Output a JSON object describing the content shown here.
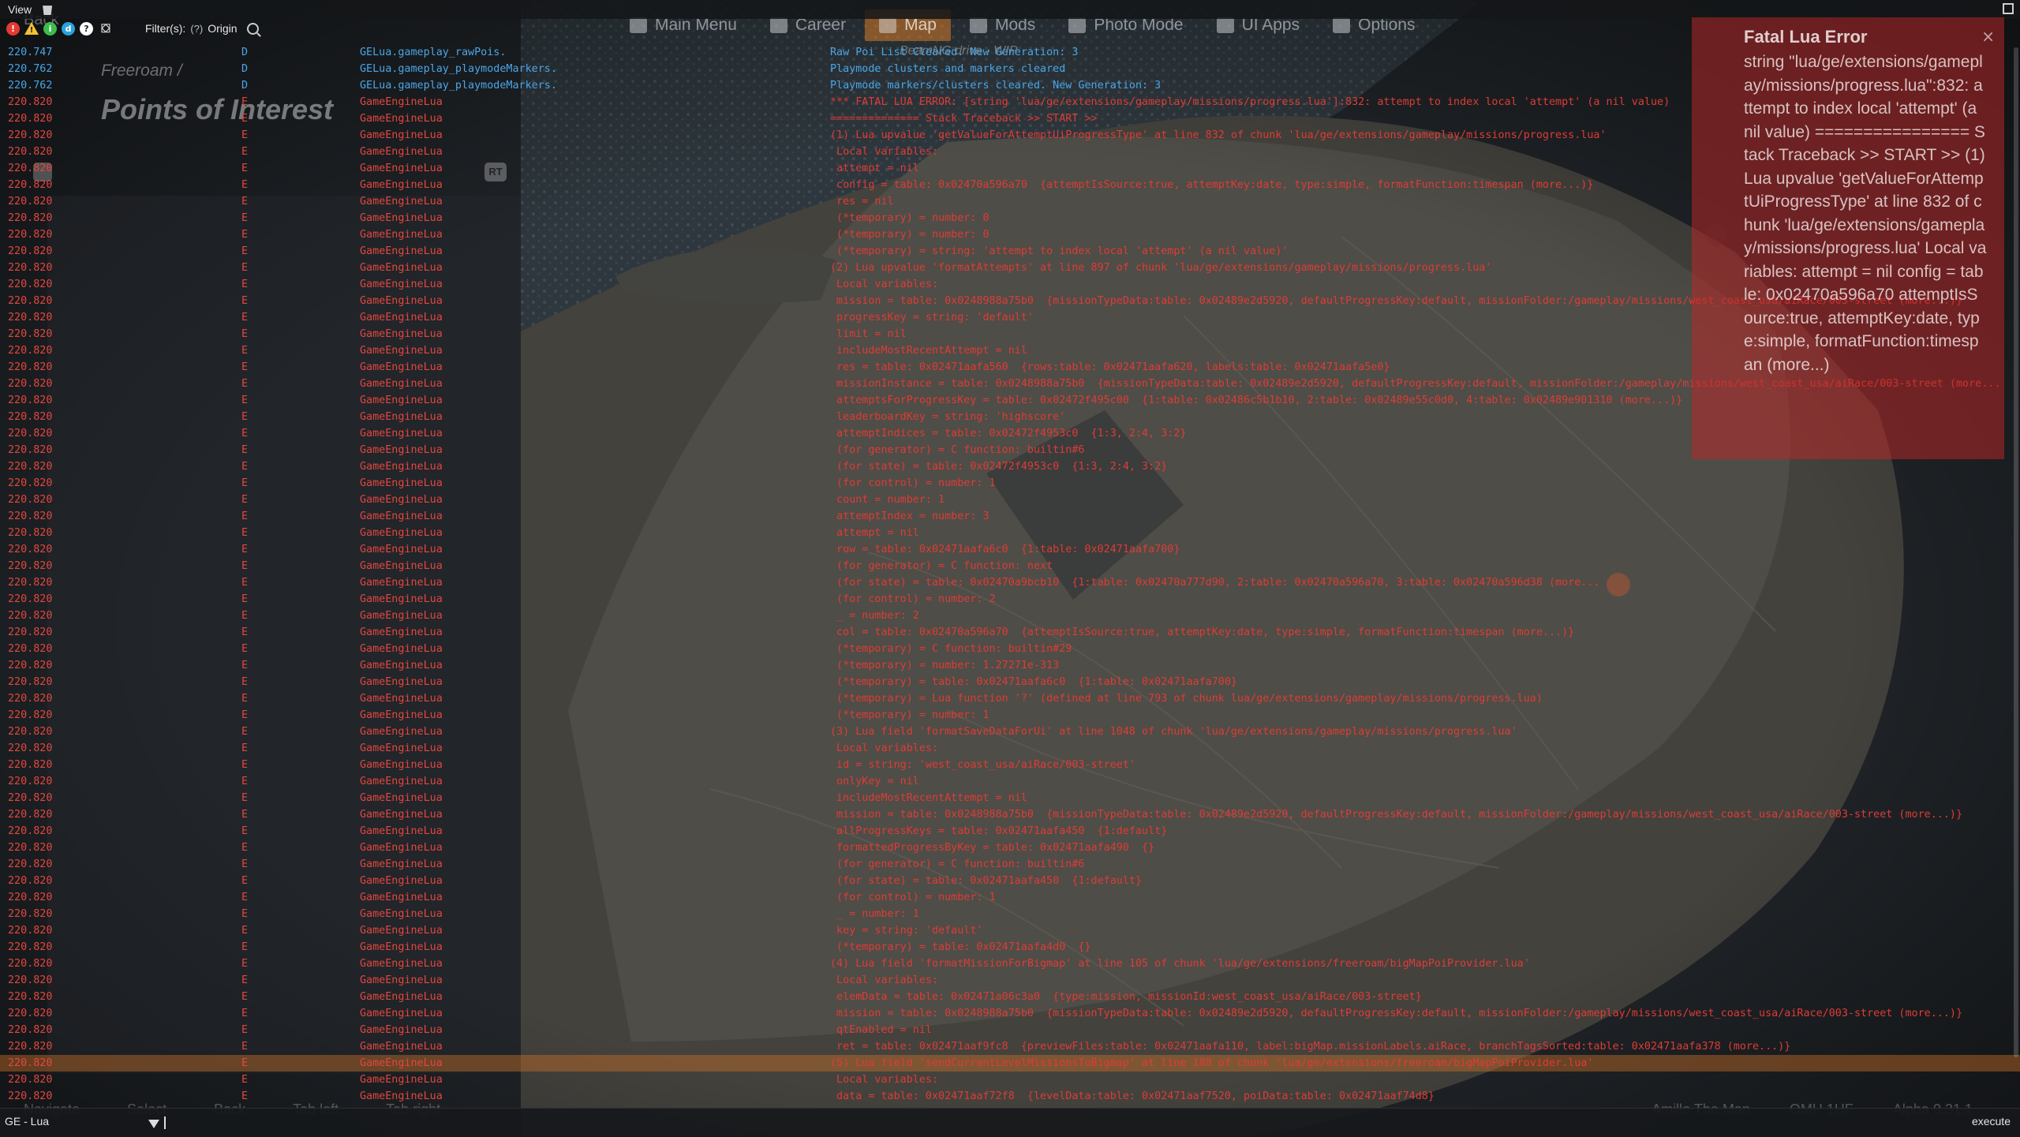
{
  "topbar": {
    "menu_view": "View"
  },
  "toolbar": {
    "filter_label": "Filter(s):",
    "filter_help": "(?)",
    "filter_value": "Origin"
  },
  "ghost": {
    "back": "Back",
    "nav": [
      "Main Menu",
      "Career",
      "Map",
      "Mods",
      "Photo Mode",
      "UI Apps",
      "Options"
    ],
    "nav_active_index": 2,
    "subtitle": "BeamNG.drive - WIP",
    "breadcrumb": "Freeroam /",
    "page_title": "Points of Interest",
    "rt_badge": "RT",
    "bottom_left": [
      "Navigate",
      "Select",
      "Back",
      "Tab left",
      "Tab right"
    ],
    "bottom_right": [
      "Amillo The Man",
      "OMH 1HF",
      "Alpha 0.31.1"
    ]
  },
  "log": {
    "rows": [
      {
        "t": "220.747",
        "l": "D",
        "o": "GELua.gameplay_rawPois.",
        "m": "Raw Poi List Cleared. New Generation: 3"
      },
      {
        "t": "220.762",
        "l": "D",
        "o": "GELua.gameplay_playmodeMarkers.",
        "m": "Playmode clusters and markers cleared"
      },
      {
        "t": "220.762",
        "l": "D",
        "o": "GELua.gameplay_playmodeMarkers.",
        "m": "Playmode markers/clusters cleared. New Generation: 3"
      },
      {
        "t": "220.820",
        "l": "E",
        "o": "GameEngineLua",
        "m": "*** FATAL LUA ERROR: [string 'lua/ge/extensions/gameplay/missions/progress.lua']:832: attempt to index local 'attempt' (a nil value)"
      },
      {
        "t": "220.820",
        "l": "E",
        "o": "GameEngineLua",
        "m": "============== Stack Traceback >> START >>"
      },
      {
        "t": "220.820",
        "l": "E",
        "o": "GameEngineLua",
        "m": "(1) Lua upvalue 'getValueForAttemptUiProgressType' at line 832 of chunk 'lua/ge/extensions/gameplay/missions/progress.lua'"
      },
      {
        "t": "220.820",
        "l": "E",
        "o": "GameEngineLua",
        "m": " Local variables:"
      },
      {
        "t": "220.820",
        "l": "E",
        "o": "GameEngineLua",
        "m": " attempt = nil"
      },
      {
        "t": "220.820",
        "l": "E",
        "o": "GameEngineLua",
        "m": " config = table: 0x02470a596a70  {attemptIsSource:true, attemptKey:date, type:simple, formatFunction:timespan (more...)}"
      },
      {
        "t": "220.820",
        "l": "E",
        "o": "GameEngineLua",
        "m": " res = nil"
      },
      {
        "t": "220.820",
        "l": "E",
        "o": "GameEngineLua",
        "m": " (*temporary) = number: 0"
      },
      {
        "t": "220.820",
        "l": "E",
        "o": "GameEngineLua",
        "m": " (*temporary) = number: 0"
      },
      {
        "t": "220.820",
        "l": "E",
        "o": "GameEngineLua",
        "m": " (*temporary) = string: 'attempt to index local 'attempt' (a nil value)'"
      },
      {
        "t": "220.820",
        "l": "E",
        "o": "GameEngineLua",
        "m": "(2) Lua upvalue 'formatAttempts' at line 897 of chunk 'lua/ge/extensions/gameplay/missions/progress.lua'"
      },
      {
        "t": "220.820",
        "l": "E",
        "o": "GameEngineLua",
        "m": " Local variables:"
      },
      {
        "t": "220.820",
        "l": "E",
        "o": "GameEngineLua",
        "m": " mission = table: 0x0248988a75b0  {missionTypeData:table: 0x02489e2d5920, defaultProgressKey:default, missionFolder:/gameplay/missions/west_coast_usa/aiRace/003-street (more...)}"
      },
      {
        "t": "220.820",
        "l": "E",
        "o": "GameEngineLua",
        "m": " progressKey = string: 'default'"
      },
      {
        "t": "220.820",
        "l": "E",
        "o": "GameEngineLua",
        "m": " limit = nil"
      },
      {
        "t": "220.820",
        "l": "E",
        "o": "GameEngineLua",
        "m": " includeMostRecentAttempt = nil"
      },
      {
        "t": "220.820",
        "l": "E",
        "o": "GameEngineLua",
        "m": " res = table: 0x02471aafa560  {rows:table: 0x02471aafa620, labels:table: 0x02471aafa5e0}"
      },
      {
        "t": "220.820",
        "l": "E",
        "o": "GameEngineLua",
        "m": " missionInstance = table: 0x0248988a75b0  {missionTypeData:table: 0x02489e2d5920, defaultProgressKey:default, missionFolder:/gameplay/missions/west_coast_usa/aiRace/003-street (more..."
      },
      {
        "t": "220.820",
        "l": "E",
        "o": "GameEngineLua",
        "m": " attemptsForProgressKey = table: 0x02472f495c00  {1:table: 0x02486c5b1b10, 2:table: 0x02489e55c0d0, 4:table: 0x02489e901310 (more...)}"
      },
      {
        "t": "220.820",
        "l": "E",
        "o": "GameEngineLua",
        "m": " leaderboardKey = string: 'highscore'"
      },
      {
        "t": "220.820",
        "l": "E",
        "o": "GameEngineLua",
        "m": " attemptIndices = table: 0x02472f4953c0  {1:3, 2:4, 3:2}"
      },
      {
        "t": "220.820",
        "l": "E",
        "o": "GameEngineLua",
        "m": " (for generator) = C function: builtin#6"
      },
      {
        "t": "220.820",
        "l": "E",
        "o": "GameEngineLua",
        "m": " (for state) = table: 0x02472f4953c0  {1:3, 2:4, 3:2}"
      },
      {
        "t": "220.820",
        "l": "E",
        "o": "GameEngineLua",
        "m": " (for control) = number: 1"
      },
      {
        "t": "220.820",
        "l": "E",
        "o": "GameEngineLua",
        "m": " count = number: 1"
      },
      {
        "t": "220.820",
        "l": "E",
        "o": "GameEngineLua",
        "m": " attemptIndex = number: 3"
      },
      {
        "t": "220.820",
        "l": "E",
        "o": "GameEngineLua",
        "m": " attempt = nil"
      },
      {
        "t": "220.820",
        "l": "E",
        "o": "GameEngineLua",
        "m": " row = table: 0x02471aafa6c0  {1:table: 0x02471aafa700}"
      },
      {
        "t": "220.820",
        "l": "E",
        "o": "GameEngineLua",
        "m": " (for generator) = C function: next"
      },
      {
        "t": "220.820",
        "l": "E",
        "o": "GameEngineLua",
        "m": " (for state) = table: 0x02470a9bcb10  {1:table: 0x02470a777d90, 2:table: 0x02470a596a70, 3:table: 0x02470a596d38 (more..."
      },
      {
        "t": "220.820",
        "l": "E",
        "o": "GameEngineLua",
        "m": " (for control) = number: 2"
      },
      {
        "t": "220.820",
        "l": "E",
        "o": "GameEngineLua",
        "m": " _ = number: 2"
      },
      {
        "t": "220.820",
        "l": "E",
        "o": "GameEngineLua",
        "m": " col = table: 0x02470a596a70  {attemptIsSource:true, attemptKey:date, type:simple, formatFunction:timespan (more...)}"
      },
      {
        "t": "220.820",
        "l": "E",
        "o": "GameEngineLua",
        "m": " (*temporary) = C function: builtin#29"
      },
      {
        "t": "220.820",
        "l": "E",
        "o": "GameEngineLua",
        "m": " (*temporary) = number: 1.27271e-313"
      },
      {
        "t": "220.820",
        "l": "E",
        "o": "GameEngineLua",
        "m": " (*temporary) = table: 0x02471aafa6c0  {1:table: 0x02471aafa700}"
      },
      {
        "t": "220.820",
        "l": "E",
        "o": "GameEngineLua",
        "m": " (*temporary) = Lua function '?' (defined at line 793 of chunk lua/ge/extensions/gameplay/missions/progress.lua)"
      },
      {
        "t": "220.820",
        "l": "E",
        "o": "GameEngineLua",
        "m": " (*temporary) = number: 1"
      },
      {
        "t": "220.820",
        "l": "E",
        "o": "GameEngineLua",
        "m": "(3) Lua field 'formatSaveDataForUi' at line 1048 of chunk 'lua/ge/extensions/gameplay/missions/progress.lua'"
      },
      {
        "t": "220.820",
        "l": "E",
        "o": "GameEngineLua",
        "m": " Local variables:"
      },
      {
        "t": "220.820",
        "l": "E",
        "o": "GameEngineLua",
        "m": " id = string: 'west_coast_usa/aiRace/003-street'"
      },
      {
        "t": "220.820",
        "l": "E",
        "o": "GameEngineLua",
        "m": " onlyKey = nil"
      },
      {
        "t": "220.820",
        "l": "E",
        "o": "GameEngineLua",
        "m": " includeMostRecentAttempt = nil"
      },
      {
        "t": "220.820",
        "l": "E",
        "o": "GameEngineLua",
        "m": " mission = table: 0x0248988a75b0  {missionTypeData:table: 0x02489e2d5920, defaultProgressKey:default, missionFolder:/gameplay/missions/west_coast_usa/aiRace/003-street (more...)}"
      },
      {
        "t": "220.820",
        "l": "E",
        "o": "GameEngineLua",
        "m": " allProgressKeys = table: 0x02471aafa450  {1:default}"
      },
      {
        "t": "220.820",
        "l": "E",
        "o": "GameEngineLua",
        "m": " formattedProgressByKey = table: 0x02471aafa490  {}"
      },
      {
        "t": "220.820",
        "l": "E",
        "o": "GameEngineLua",
        "m": " (for generator) = C function: builtin#6"
      },
      {
        "t": "220.820",
        "l": "E",
        "o": "GameEngineLua",
        "m": " (for state) = table: 0x02471aafa450  {1:default}"
      },
      {
        "t": "220.820",
        "l": "E",
        "o": "GameEngineLua",
        "m": " (for control) = number: 1"
      },
      {
        "t": "220.820",
        "l": "E",
        "o": "GameEngineLua",
        "m": " _ = number: 1"
      },
      {
        "t": "220.820",
        "l": "E",
        "o": "GameEngineLua",
        "m": " key = string: 'default'"
      },
      {
        "t": "220.820",
        "l": "E",
        "o": "GameEngineLua",
        "m": " (*temporary) = table: 0x02471aafa4d0  {}"
      },
      {
        "t": "220.820",
        "l": "E",
        "o": "GameEngineLua",
        "m": "(4) Lua field 'formatMissionForBigmap' at line 105 of chunk 'lua/ge/extensions/freeroam/bigMapPoiProvider.lua'"
      },
      {
        "t": "220.820",
        "l": "E",
        "o": "GameEngineLua",
        "m": " Local variables:"
      },
      {
        "t": "220.820",
        "l": "E",
        "o": "GameEngineLua",
        "m": " elemData = table: 0x02471a06c3a0  {type:mission, missionId:west_coast_usa/aiRace/003-street}"
      },
      {
        "t": "220.820",
        "l": "E",
        "o": "GameEngineLua",
        "m": " mission = table: 0x0248988a75b0  {missionTypeData:table: 0x02489e2d5920, defaultProgressKey:default, missionFolder:/gameplay/missions/west_coast_usa/aiRace/003-street (more...)}"
      },
      {
        "t": "220.820",
        "l": "E",
        "o": "GameEngineLua",
        "m": " qtEnabled = nil"
      },
      {
        "t": "220.820",
        "l": "E",
        "o": "GameEngineLua",
        "m": " ret = table: 0x02471aaf9fc8  {previewFiles:table: 0x02471aafa110, label:bigMap.missionLabels.aiRace, branchTagsSorted:table: 0x02471aafa378 (more...)}"
      },
      {
        "t": "220.820",
        "l": "E",
        "o": "GameEngineLua",
        "m": "(5) Lua field 'sendCurrentLevelMissionsToBigmap' at line 188 of chunk 'lua/ge/extensions/freeroam/bigMapPoiProvider.lua'"
      },
      {
        "t": "220.820",
        "l": "E",
        "o": "GameEngineLua",
        "m": " Local variables:"
      },
      {
        "t": "220.820",
        "l": "E",
        "o": "GameEngineLua",
        "m": " data = table: 0x02471aaf72f8  {levelData:table: 0x02471aaf7520, poiData:table: 0x02471aaf74d8}"
      }
    ],
    "highlight_index": 61
  },
  "fatal": {
    "title": "Fatal Lua Error",
    "close": "×",
    "body": "string \"lua/ge/extensions/gameplay/missions/progress.lua\":832: attempt to index local 'attempt' (a nil value) ================ Stack Traceback >> START >> (1) Lua upvalue 'getValueForAttemptUiProgressType' at line 832 of chunk 'lua/ge/extensions/gameplay/missions/progress.lua' Local variables: attempt = nil config = table: 0x02470a596a70 attemptIsSource:true, attemptKey:date, type:simple, formatFunction:timespan (more...)"
  },
  "cmdbar": {
    "context": "GE - Lua",
    "input_value": "",
    "execute": "execute"
  },
  "colors": {
    "debug": "#4aa6e8",
    "error": "#e2473f",
    "highlight": "#c86e28",
    "fatal_bg": "#be2828"
  }
}
